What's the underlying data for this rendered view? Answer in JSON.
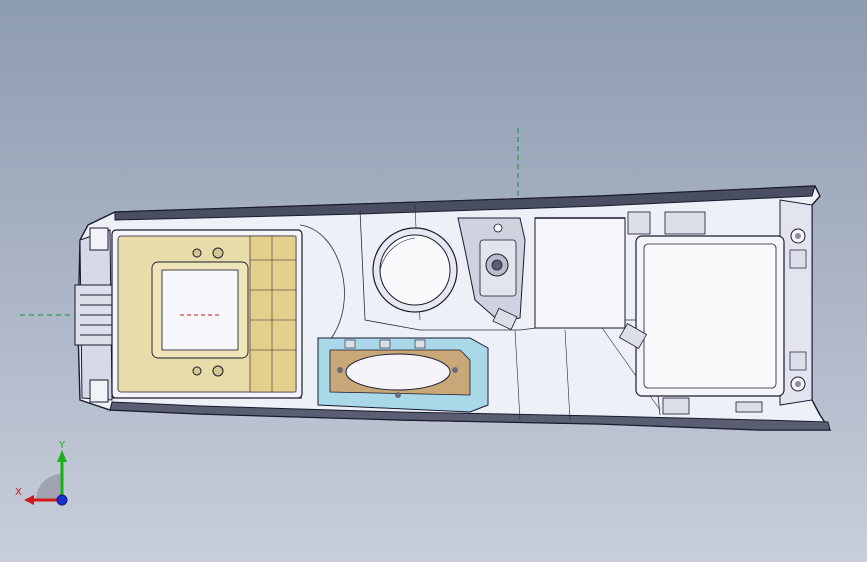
{
  "viewport": {
    "background_top": "#8d9bb0",
    "background_bottom": "#c8ceda"
  },
  "model": {
    "name_icon": "center-console-cad-model-icon",
    "outline_color": "#1a1a2e",
    "surface_color": "#eef0f8",
    "tray_color": "#e8dcaa",
    "bracket_color": "#a9d9e8",
    "cup_color": "#c8a878"
  },
  "triad": {
    "x_label": "X",
    "y_label": "Y",
    "x_color": "#d01818",
    "y_color": "#18b018",
    "z_color": "#1830d0"
  },
  "datum": {
    "color": "#1a8a3a"
  }
}
